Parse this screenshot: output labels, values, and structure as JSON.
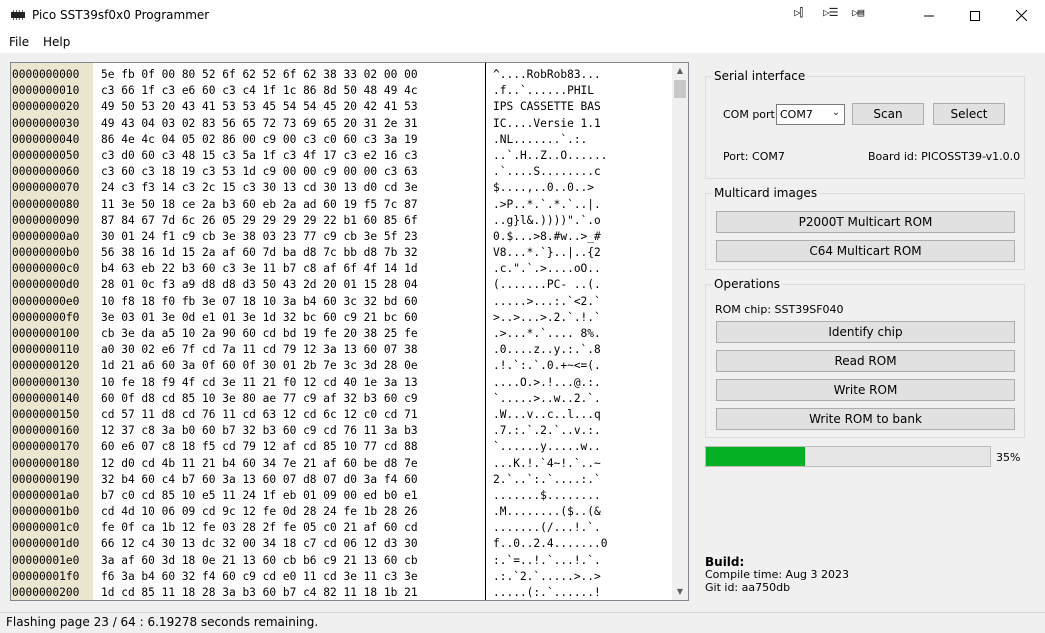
{
  "window": {
    "title": "Pico SST39sf0x0 Programmer",
    "controls": [
      "minimize",
      "maximize",
      "close"
    ]
  },
  "menu": [
    "File",
    "Help"
  ],
  "hex": {
    "rows": [
      {
        "addr": "0000000000",
        "bytes": "5e fb 0f 00 80 52 6f 62 52 6f 62 38 33 02 00 00",
        "ascii": "^....RobRob83..."
      },
      {
        "addr": "0000000010",
        "bytes": "c3 66 1f c3 e6 60 c3 c4 1f 1c 86 8d 50 48 49 4c",
        "ascii": ".f..`......PHIL"
      },
      {
        "addr": "0000000020",
        "bytes": "49 50 53 20 43 41 53 53 45 54 54 45 20 42 41 53",
        "ascii": "IPS CASSETTE BAS"
      },
      {
        "addr": "0000000030",
        "bytes": "49 43 04 03 02 83 56 65 72 73 69 65 20 31 2e 31",
        "ascii": "IC....Versie 1.1"
      },
      {
        "addr": "0000000040",
        "bytes": "86 4e 4c 04 05 02 86 00 c9 00 c3 c0 60 c3 3a 19",
        "ascii": ".NL.......`.:."
      },
      {
        "addr": "0000000050",
        "bytes": "c3 d0 60 c3 48 15 c3 5a 1f c3 4f 17 c3 e2 16 c3",
        "ascii": "..`.H..Z..O......"
      },
      {
        "addr": "0000000060",
        "bytes": "c3 60 c3 18 19 c3 53 1d c9 00 00 c9 00 00 c3 63",
        "ascii": ".`....S........c"
      },
      {
        "addr": "0000000070",
        "bytes": "24 c3 f3 14 c3 2c 15 c3 30 13 cd 30 13 d0 cd 3e",
        "ascii": "$....,..0..0..>"
      },
      {
        "addr": "0000000080",
        "bytes": "11 3e 50 18 ce 2a b3 60 eb 2a ad 60 19 f5 7c 87",
        "ascii": ".>P..*.`.*.`..|."
      },
      {
        "addr": "0000000090",
        "bytes": "87 84 67 7d 6c 26 05 29 29 29 29 22 b1 60 85 6f",
        "ascii": "..g}l&.))))\".`.o"
      },
      {
        "addr": "00000000a0",
        "bytes": "30 01 24 f1 c9 cb 3e 38 03 23 77 c9 cb 3e 5f 23",
        "ascii": "0.$...>8.#w..>_#"
      },
      {
        "addr": "00000000b0",
        "bytes": "56 38 16 1d 15 2a af 60 7d ba d8 7c bb d8 7b 32",
        "ascii": "V8...*.`}..|..{2"
      },
      {
        "addr": "00000000c0",
        "bytes": "b4 63 eb 22 b3 60 c3 3e 11 b7 c8 af 6f 4f 14 1d",
        "ascii": ".c.\".`.>....oO.."
      },
      {
        "addr": "00000000d0",
        "bytes": "28 01 0c f3 a9 d8 d8 d3 50 43 2d 20 01 15 28 04",
        "ascii": "(.......PC- ..(."
      },
      {
        "addr": "00000000e0",
        "bytes": "10 f8 18 f0 fb 3e 07 18 10 3a b4 60 3c 32 bd 60",
        "ascii": ".....>...:.`<2.`"
      },
      {
        "addr": "00000000f0",
        "bytes": "3e 03 01 3e 0d e1 01 3e 1d 32 bc 60 c9 21 bc 60",
        "ascii": ">..>...>.2.`.!.`"
      },
      {
        "addr": "0000000100",
        "bytes": "cb 3e da a5 10 2a 90 60 cd bd 19 fe 20 38 25 fe",
        "ascii": ".>...*.`.... 8%."
      },
      {
        "addr": "0000000110",
        "bytes": "a0 30 02 e6 7f cd 7a 11 cd 79 12 3a 13 60 07 38",
        "ascii": ".0....z..y.:.`.8"
      },
      {
        "addr": "0000000120",
        "bytes": "1d 21 a6 60 3a 0f 60 0f 30 01 2b 7e 3c 3d 28 0e",
        "ascii": ".!.`:.`.0.+~<=(."
      },
      {
        "addr": "0000000130",
        "bytes": "10 fe 18 f9 4f cd 3e 11 21 f0 12 cd 40 1e 3a 13",
        "ascii": "....O.>.!...@.:."
      },
      {
        "addr": "0000000140",
        "bytes": "60 0f d8 cd 85 10 3e 80 ae 77 c9 af 32 b3 60 c9",
        "ascii": "`.....>..w..2.`."
      },
      {
        "addr": "0000000150",
        "bytes": "cd 57 11 d8 cd 76 11 cd 63 12 cd 6c 12 c0 cd 71",
        "ascii": ".W...v..c..l...q"
      },
      {
        "addr": "0000000160",
        "bytes": "12 37 c8 3a b0 60 b7 32 b3 60 c9 cd 76 11 3a b3",
        "ascii": ".7.:.`.2.`..v.:."
      },
      {
        "addr": "0000000170",
        "bytes": "60 e6 07 c8 18 f5 cd 79 12 af cd 85 10 77 cd 88",
        "ascii": "`......y.....w.."
      },
      {
        "addr": "0000000180",
        "bytes": "12 d0 cd 4b 11 21 b4 60 34 7e 21 af 60 be d8 7e",
        "ascii": "...K.!.`4~!.`..~"
      },
      {
        "addr": "0000000190",
        "bytes": "32 b4 60 c4 b7 60 3a 13 60 07 d8 07 d0 3a f4 60",
        "ascii": "2.`..`:.`....:.`"
      },
      {
        "addr": "00000001a0",
        "bytes": "b7 c0 cd 85 10 e5 11 24 1f eb 01 09 00 ed b0 e1",
        "ascii": ".......$........"
      },
      {
        "addr": "00000001b0",
        "bytes": "cd 4d 10 06 09 cd 9c 12 fe 0d 28 24 fe 1b 28 26",
        "ascii": ".M........($..(&"
      },
      {
        "addr": "00000001c0",
        "bytes": "fe 0f ca 1b 12 fe 03 28 2f fe 05 c0 21 af 60 cd",
        "ascii": ".......(/...!.`."
      },
      {
        "addr": "00000001d0",
        "bytes": "66 12 c4 30 13 dc 32 00 34 18 c7 cd 06 12 d3 30",
        "ascii": "f..0..2.4.......0"
      },
      {
        "addr": "00000001e0",
        "bytes": "3a af 60 3d 18 0e 21 13 60 cb b6 c9 21 13 60 cb",
        "ascii": ":.`=..!.`...!.`."
      },
      {
        "addr": "00000001f0",
        "bytes": "f6 3a b4 60 32 f4 60 c9 cd e0 11 cd 3e 11 c3 3e",
        "ascii": ".:.`2.`.....>..>"
      },
      {
        "addr": "0000000200",
        "bytes": "1d cd 85 11 18 28 3a b3 60 b7 c4 82 11 18 1b 21",
        "ascii": ".....(:.`......!"
      }
    ]
  },
  "serial": {
    "title": "Serial interface",
    "com_label": "COM port",
    "com_value": "COM7",
    "scan_label": "Scan",
    "select_label": "Select",
    "port_text": "Port: COM7",
    "board_text": "Board id: PICOSST39-v1.0.0"
  },
  "multicard": {
    "title": "Multicard images",
    "buttons": [
      "P2000T Multicart ROM",
      "C64 Multicart ROM"
    ]
  },
  "operations": {
    "title": "Operations",
    "rom_chip": "ROM chip: SST39SF040",
    "buttons": [
      "Identify chip",
      "Read ROM",
      "Write ROM",
      "Write ROM to bank"
    ]
  },
  "progress": {
    "fraction": 0.35,
    "label": "35%",
    "color": "#06b025"
  },
  "build": {
    "heading": "Build:",
    "compile_time": "Compile time: Aug 3 2023",
    "git_id": "Git id: aa750db"
  },
  "status": "Flashing page 23 / 64 : 6.19278 seconds remaining."
}
